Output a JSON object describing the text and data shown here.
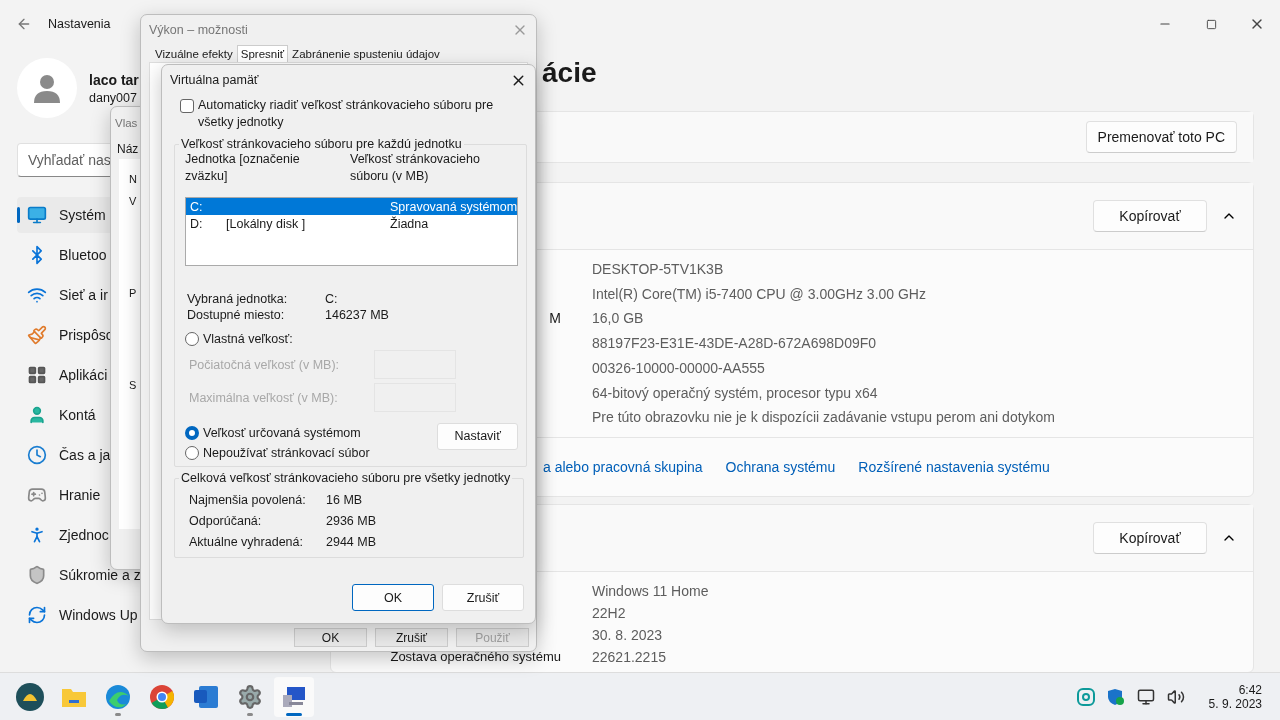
{
  "settings": {
    "title": "Nastavenia",
    "user": {
      "name": "laco tar",
      "email": "dany007"
    },
    "search": {
      "placeholder": "Vyhľadať nas"
    },
    "nav": [
      {
        "label": "Systém",
        "selected": true
      },
      {
        "label": "Bluetoo",
        "selected": false
      },
      {
        "label": "Sieť a ir",
        "selected": false
      },
      {
        "label": "Prispôsc",
        "selected": false
      },
      {
        "label": "Aplikáci",
        "selected": false
      },
      {
        "label": "Kontá",
        "selected": false
      },
      {
        "label": "Čas a ja",
        "selected": false
      },
      {
        "label": "Hranie",
        "selected": false
      },
      {
        "label": "Zjednoc",
        "selected": false
      },
      {
        "label": "Súkromie a z",
        "selected": false
      },
      {
        "label": "Windows Up",
        "selected": false
      }
    ],
    "page_title": "ácie",
    "rename_button": "Premenovať toto PC",
    "sections": [
      {
        "copy_button": "Kopírovať",
        "expanded": true,
        "rows": [
          {
            "value": "DESKTOP-5TV1K3B"
          },
          {
            "value": "Intel(R) Core(TM) i5-7400 CPU @ 3.00GHz   3.00 GHz"
          },
          {
            "label": "M",
            "value": "16,0 GB"
          },
          {
            "value": "88197F23-E31E-43DE-A28D-672A698D09F0"
          },
          {
            "value": "00326-10000-00000-AA555"
          },
          {
            "value": "64-bitový operačný systém, procesor typu x64"
          },
          {
            "value": "Pre túto obrazovku nie je k dispozícii zadávanie vstupu perom ani dotykom"
          }
        ],
        "links": [
          "a alebo pracovná skupina",
          "Ochrana systému",
          "Rozšírené nastavenia systému"
        ]
      },
      {
        "copy_button": "Kopírovať",
        "expanded": true,
        "rows": [
          {
            "value": "Windows 11 Home"
          },
          {
            "value": "22H2"
          },
          {
            "value": "30. 8. 2023"
          },
          {
            "label": "Zostava operačného systému",
            "value": "22621.2215"
          }
        ]
      }
    ]
  },
  "system_properties": {
    "title": "Vlas",
    "tab": "Náz",
    "fragments": [
      "N",
      "V",
      "P",
      "S"
    ]
  },
  "performance_options": {
    "title": "Výkon – možnosti",
    "tabs": [
      {
        "label": "Vizuálne efekty",
        "selected": false
      },
      {
        "label": "Spresniť",
        "selected": true
      },
      {
        "label": "Zabránenie spusteniu údajov",
        "selected": false
      }
    ],
    "buttons": [
      {
        "label": "OK",
        "disabled": false
      },
      {
        "label": "Zrušiť",
        "disabled": false
      },
      {
        "label": "Použiť",
        "disabled": true
      }
    ]
  },
  "virtual_memory": {
    "title": "Virtuálna pamäť",
    "auto": {
      "label": "Automaticky riadiť veľkosť stránkovacieho súboru pre všetky jednotky",
      "checked": false
    },
    "per_drive": {
      "legend": "Veľkosť stránkovacieho súboru pre každú jednotku",
      "columns": [
        "Jednotka [označenie zväzku]",
        "Veľkosť stránkovacieho súboru (v MB)"
      ],
      "drives": [
        {
          "letter": "C:",
          "size": "Spravovaná systémom",
          "selected": true
        },
        {
          "letter": "D:",
          "label": "[Lokálny disk ]",
          "size": "Žiadna",
          "selected": false
        }
      ],
      "info": [
        {
          "label": "Vybraná jednotka:",
          "value": "C:"
        },
        {
          "label": "Dostupné miesto:",
          "value": "146237 MB"
        }
      ],
      "options": [
        {
          "kind": "custom",
          "label": "Vlastná veľkosť:",
          "selected": false
        },
        {
          "kind": "system",
          "label": "Veľkosť určovaná systémom",
          "selected": true
        },
        {
          "kind": "none",
          "label": "Nepoužívať stránkovací súbor",
          "selected": false
        }
      ],
      "size_fields": [
        {
          "label": "Počiatočná veľkosť (v MB):",
          "disabled": true
        },
        {
          "label": "Maximálna veľkosť (v MB):",
          "disabled": true
        }
      ],
      "set_button": "Nastaviť"
    },
    "totals": {
      "legend": "Celková veľkosť stránkovacieho súboru pre všetky jednotky",
      "rows": [
        {
          "label": "Najmenšia povolená:",
          "value": "16 MB"
        },
        {
          "label": "Odporúčaná:",
          "value": "2936 MB"
        },
        {
          "label": "Aktuálne vyhradená:",
          "value": "2944 MB"
        }
      ]
    },
    "buttons": [
      {
        "label": "OK",
        "default": true
      },
      {
        "label": "Zrušiť",
        "default": false
      }
    ]
  },
  "taskbar": {
    "apps": [
      {
        "running": false,
        "active": false
      },
      {
        "running": false,
        "active": false
      },
      {
        "running": true,
        "active": false
      },
      {
        "running": false,
        "active": false
      },
      {
        "running": false,
        "active": false
      },
      {
        "running": true,
        "active": false
      },
      {
        "running": true,
        "active": true
      }
    ],
    "time": "6:42",
    "date": "5. 9. 2023"
  }
}
